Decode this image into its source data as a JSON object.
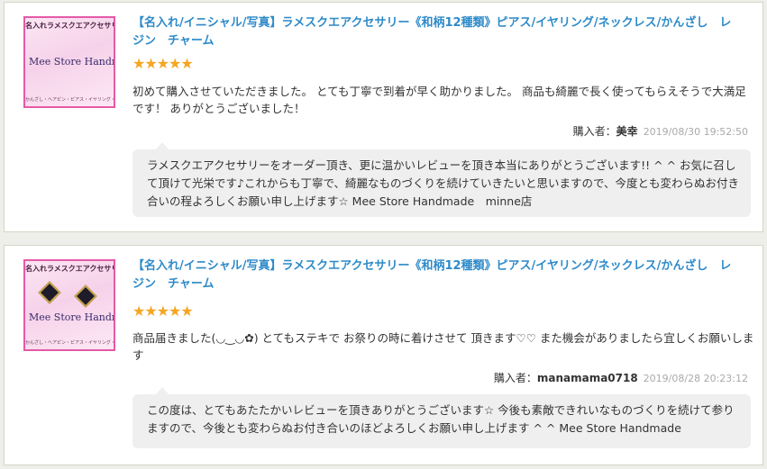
{
  "reviews": [
    {
      "thumb": {
        "title": "名入れラメスクエアクセサリー",
        "brand": "Mee Store Handmade",
        "sub": "かんざし・ヘアピン・ピアス・イヤリング・ネックレス"
      },
      "product_title": "【名入れ/イニシャル/写真】ラメスクエアクセサリー《和柄12種類》ピアス/イヤリング/ネックレス/かんざし　レジン　チャーム",
      "stars": "★★★★★",
      "rating": 5,
      "text": "初めて購入させていただきました。 とても丁寧で到着が早く助かりました。 商品も綺麗で長く使ってもらえそうで大満足です！ ありがとうございました！",
      "buyer_label": "購入者：",
      "buyer_name": "美幸",
      "date": "2019/08/30 19:52:50",
      "reply": "ラメスクエアクセサリーをオーダー頂き、更に温かいレビューを頂き本当にありがとうございます!! ^ ^ お気に召して頂けて光栄です♪これからも丁寧で、綺麗なものづくりを続けていきたいと思いますので、今度とも変わらぬお付き合いの程よろしくお願い申し上げます☆ Mee Store Handmade　minne店"
    },
    {
      "thumb": {
        "title": "名入れラメスクエアクセサリー",
        "brand": "Mee Store Handmade",
        "sub": "かんざし・ヘアピン・ピアス・イヤリング・ネックレス"
      },
      "product_title": "【名入れ/イニシャル/写真】ラメスクエアクセサリー《和柄12種類》ピアス/イヤリング/ネックレス/かんざし　レジン　チャーム",
      "stars": "★★★★★",
      "rating": 5,
      "text": "商品届きました(◡‿◡✿) とてもステキで お祭りの時に着けさせて 頂きます♡♡ また機会がありましたら宜しくお願いします",
      "buyer_label": "購入者：",
      "buyer_name": "manamama0718",
      "date": "2019/08/28 20:23:12",
      "reply": "この度は、とてもあたたかいレビューを頂きありがとうございます☆ 今後も素敵できれいなものづくりを続けて参りますので、今後とも変わらぬお付き合いのほどよろしくお願い申し上げます ^ ^ Mee Store Handmade"
    }
  ],
  "colors": {
    "title": "#2d8ac9",
    "star": "#f5a623",
    "reply_bg": "#efefef",
    "thumb_border": "#e45aa7"
  }
}
